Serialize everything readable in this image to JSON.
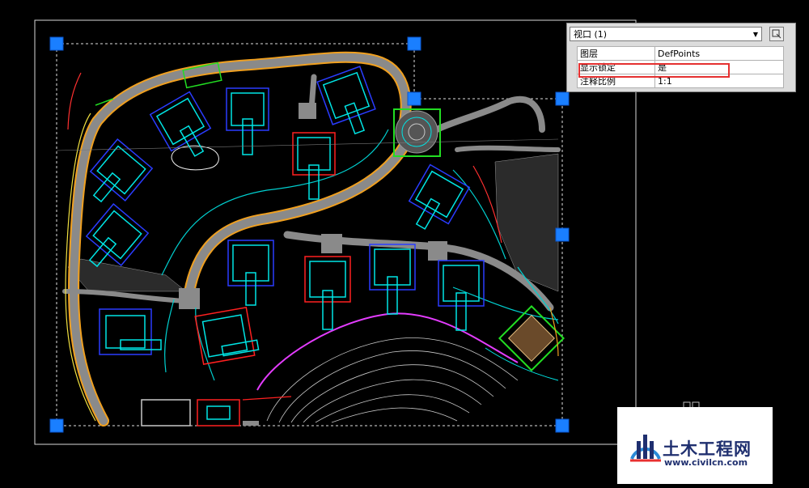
{
  "colors": {
    "background": "#000000",
    "grip": "#1a7fff",
    "road": "#8a8a8a",
    "cyan": "#00e5e5",
    "blue": "#2a3cff",
    "magenta": "#e43cff",
    "orange": "#f0a020",
    "green": "#22dd22",
    "red": "#ff2020",
    "highlight": "#e53030",
    "logo_text": "#1f2f6f"
  },
  "properties_palette": {
    "object_type": "视口 (1)",
    "quick_select_icon": "quick-select-icon",
    "rows": [
      {
        "key": "图层",
        "value": "DefPoints"
      },
      {
        "key": "显示锁定",
        "value": "是"
      },
      {
        "key": "注释比例",
        "value": "1:1"
      }
    ]
  },
  "watermark": {
    "brand": "土木工程网",
    "url": "www.civilcn.com"
  }
}
